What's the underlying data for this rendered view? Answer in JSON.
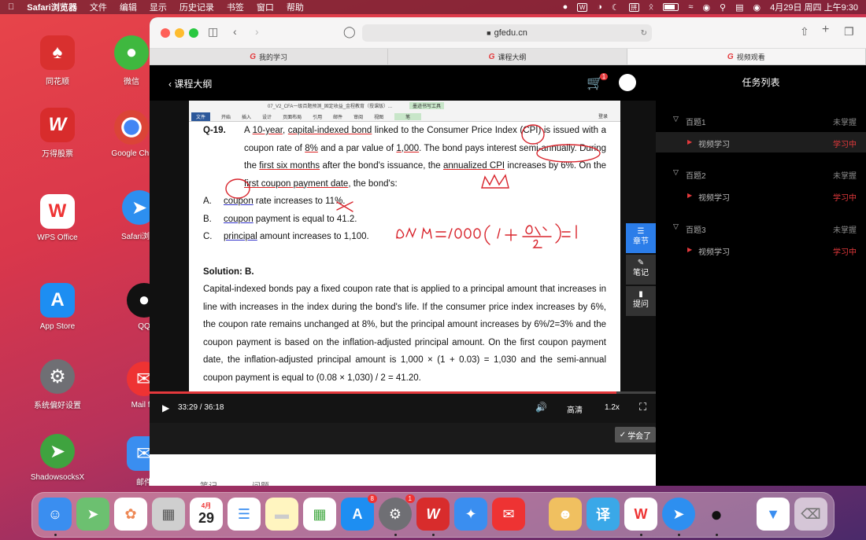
{
  "menubar": {
    "app": "Safari浏览器",
    "items": [
      "文件",
      "编辑",
      "显示",
      "历史记录",
      "书签",
      "窗口",
      "帮助"
    ],
    "datetime": "4月29日 周四 上午9:30"
  },
  "desktop_icons": [
    {
      "label": "同花顺",
      "icon": "tonghuashun-icon"
    },
    {
      "label": "微信",
      "icon": "wechat-icon"
    },
    {
      "label": "万得股票",
      "icon": "wind-stock-icon"
    },
    {
      "label": "Google Chr",
      "icon": "chrome-icon"
    },
    {
      "label": "WPS Office",
      "icon": "wps-icon"
    },
    {
      "label": "Safari浏览",
      "icon": "safari-icon"
    },
    {
      "label": "App Store",
      "icon": "app-store-icon"
    },
    {
      "label": "QQ",
      "icon": "qq-icon"
    },
    {
      "label": "系统偏好设置",
      "icon": "settings-icon"
    },
    {
      "label": "Mail for",
      "icon": "mail-icon"
    },
    {
      "label": "ShadowsocksX",
      "icon": "shadowsocks-icon"
    },
    {
      "label": "邮件",
      "icon": "mail-app-icon"
    }
  ],
  "browser": {
    "url": "gfedu.cn",
    "tabs": [
      "我的学习",
      "课程大纲",
      "视频观看"
    ]
  },
  "player": {
    "back_label": "课程大纲",
    "cart_count": "1",
    "time": "33:29 / 36:18",
    "progress": 0.922,
    "quality": "高清",
    "speed": "1.2x",
    "learned_btn": "学会了",
    "bottom_tabs": [
      "笔记",
      "问题"
    ],
    "side_buttons": [
      {
        "label": "章节",
        "icon": "menu-icon"
      },
      {
        "label": "笔记",
        "icon": "pen-icon"
      },
      {
        "label": "提问",
        "icon": "question-icon"
      }
    ]
  },
  "document": {
    "word_title": "07_V2_CFA一级百题预测_固定收益_金程教育（授课版）...",
    "ribbon": [
      "文件",
      "开始",
      "插入",
      "设计",
      "页面布局",
      "引用",
      "邮件",
      "审阅",
      "视图",
      "笔"
    ],
    "ribbon_tool": "墨迹书写工具",
    "signin": "登录",
    "question_num": "Q-19.",
    "question_parts": {
      "p1": "A ",
      "p2": "10-year",
      "p3": ", ",
      "p4": "capital-indexed bond",
      "p5": " linked to the Consumer Price Index (",
      "p6": "CPI",
      "p7": ") is issued with a coupon rate of ",
      "p8": "8%",
      "p9": " and a par value of ",
      "p10": "1,000",
      "p11": ". The bond pays interest ",
      "p12": "semi-annually.",
      "p13": " During the ",
      "p14": "first six months",
      "p15": " after the bond's issuance, the ",
      "p16": "annualized CPI",
      "p17": " increases by ",
      "p18": "6%",
      "p19": ". On the ",
      "p20": "first coupon payment date",
      "p21": ", the bond's:"
    },
    "options": [
      {
        "letter": "A.",
        "pre": "",
        "u": "coupon",
        "post": " rate increases to 11%."
      },
      {
        "letter": "B.",
        "pre": "",
        "u": "coupon",
        "post": " payment is equal to 41.2."
      },
      {
        "letter": "C.",
        "pre": "",
        "u": "principal",
        "post": " amount increases to 1,100."
      }
    ],
    "solution_label": "Solution: B.",
    "solution_text": "Capital-indexed bonds pay a fixed coupon rate that is applied to a principal amount that increases in line with increases in the index during the bond's life. If the consumer price index increases by 6%, the coupon rate remains unchanged at 8%, but the principal amount increases by 6%/2=3% and the coupon payment is based on the inflation-adjusted principal amount. On the first coupon payment date, the inflation-adjusted principal amount is 1,000 × (1 + 0.03) = 1,030 and the semi-annual coupon payment is equal to (0.08 × 1,030) / 2 = 41.20."
  },
  "tasks": {
    "title": "任务列表",
    "sections": [
      {
        "name": "百题1",
        "status": "未掌握",
        "item": "视频学习",
        "item_status": "学习中"
      },
      {
        "name": "百题2",
        "status": "未掌握",
        "item": "视频学习",
        "item_status": "学习中"
      },
      {
        "name": "百题3",
        "status": "未掌握",
        "item": "视频学习",
        "item_status": "学习中"
      }
    ]
  },
  "dock": {
    "calendar_month": "4月",
    "calendar_day": "29",
    "appstore_badge": "8",
    "settings_badge": "1"
  }
}
